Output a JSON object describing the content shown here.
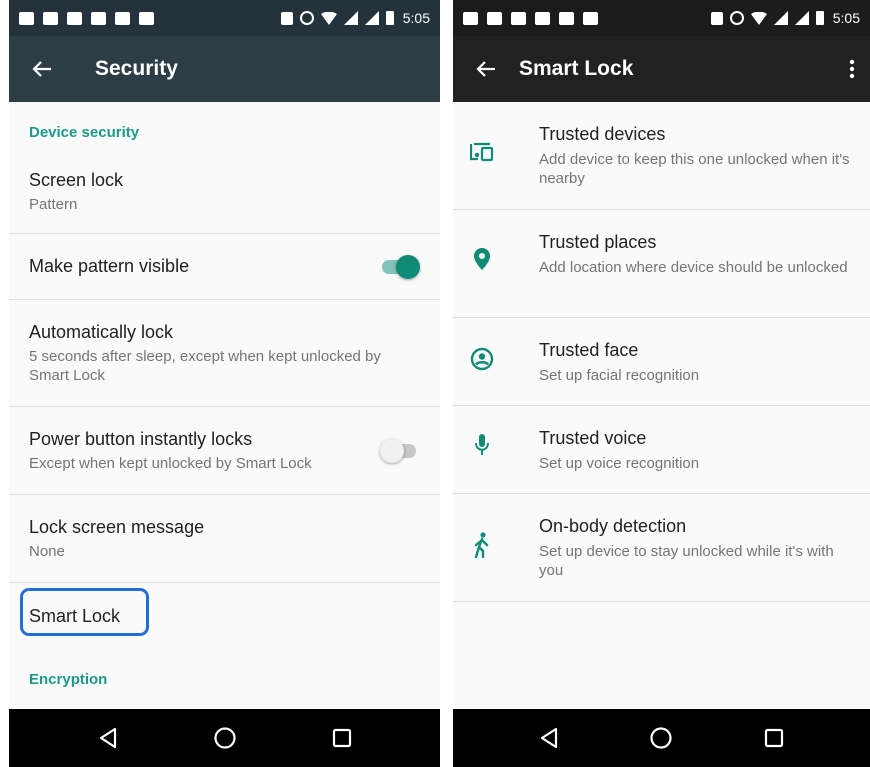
{
  "colors": {
    "accent": "#1e9a8a",
    "highlight": "#1f6fd6",
    "toggle_on": "#0f8b77"
  },
  "left": {
    "status_time": "5:05",
    "title": "Security",
    "sections": [
      {
        "header": "Device security"
      },
      {
        "header": "Encryption"
      }
    ],
    "items": [
      {
        "title": "Screen lock",
        "summary": "Pattern"
      },
      {
        "title": "Make pattern visible",
        "toggle": "on"
      },
      {
        "title": "Automatically lock",
        "summary": "5 seconds after sleep, except when kept unlocked by Smart Lock"
      },
      {
        "title": "Power button instantly locks",
        "summary": "Except when kept unlocked by Smart Lock",
        "toggle": "off"
      },
      {
        "title": "Lock screen message",
        "summary": "None"
      },
      {
        "title": "Smart Lock"
      }
    ]
  },
  "right": {
    "status_time": "5:05",
    "title": "Smart Lock",
    "items": [
      {
        "icon": "trusted-devices-icon",
        "title": "Trusted devices",
        "summary": "Add device to keep this one unlocked when it's nearby"
      },
      {
        "icon": "location-pin-icon",
        "title": "Trusted places",
        "summary": "Add location where device should be unlocked"
      },
      {
        "icon": "face-icon",
        "title": "Trusted face",
        "summary": "Set up facial recognition"
      },
      {
        "icon": "microphone-icon",
        "title": "Trusted voice",
        "summary": "Set up voice recognition"
      },
      {
        "icon": "walking-person-icon",
        "title": "On-body detection",
        "summary": "Set up device to stay unlocked while it's with you"
      }
    ]
  },
  "nav_icons": [
    "back-triangle-icon",
    "home-circle-icon",
    "recents-square-icon"
  ]
}
